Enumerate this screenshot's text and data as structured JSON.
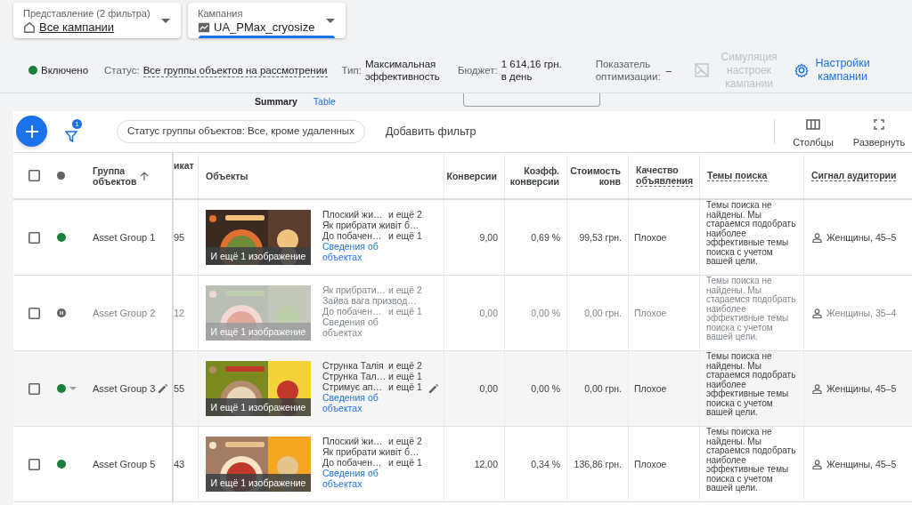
{
  "filters": [
    {
      "label": "Представление (2 фильтра)",
      "value": "Все кампании",
      "focused": false
    },
    {
      "label": "Кампания",
      "value": "UA_PMax_cryosize",
      "focused": true
    }
  ],
  "summary_bar": {
    "state": "Включено",
    "status_label": "Статус:",
    "status_value": "Все группы объектов на рассмотрении",
    "type_label": "Тип:",
    "type_value": "Максимальная эффективность",
    "budget_label": "Бюджет:",
    "budget_value": "1 614,16 грн. в день",
    "score_label": "Показатель оптимизации:",
    "score_value": "–",
    "simulation": {
      "label": "Симуляция настроек кампании",
      "disabled": true
    },
    "settings": "Настройки кампании"
  },
  "view_toggle": [
    {
      "label": "Summary",
      "selected": false
    },
    {
      "label": "Table",
      "selected": true
    }
  ],
  "toolbar": {
    "filter_count": "1",
    "filter_chip": "Статус группы объектов: Все, кроме удаленных",
    "add_filter": "Добавить фильтр",
    "columns": "Столбцы",
    "expand": "Развернуть"
  },
  "table": {
    "columns": [
      {
        "kind": "checkbox",
        "checked": false
      },
      {
        "kind": "status"
      },
      {
        "kind": "text",
        "label": "Группа объектов",
        "sorted": true
      },
      {
        "kind": "text",
        "label": "икат"
      },
      {
        "kind": "text",
        "label": "Объекты"
      },
      {
        "kind": "metric",
        "label": "Конверсии"
      },
      {
        "kind": "metric",
        "label": "Коэфф. конверсии"
      },
      {
        "kind": "metric",
        "label": "Стоимость конв"
      },
      {
        "kind": "hint",
        "label": "Качество объявления"
      },
      {
        "kind": "hint",
        "label": "Темы поиска"
      },
      {
        "kind": "hint",
        "label": "Сигнал аудитории"
      }
    ],
    "rows": [
      {
        "checked": false,
        "paused": false,
        "hovered": false,
        "name": "Asset Group 1",
        "column_3": "95",
        "images_more": "И ещё 1 изображение",
        "headlines": [
          {
            "text": "Плоский жи…",
            "more": "и ещё 2"
          },
          {
            "text": "Як прибрати живіт б…"
          },
          {
            "text": "До побачен…",
            "more": "и ещё 1"
          }
        ],
        "details_link": "Сведения об объектах",
        "conversions": "9,00",
        "conv_rate": "0,69 %",
        "cost_per_conv": "99,53 грн.",
        "ad_strength": "Плохое",
        "search_themes": "Темы поиска не найдены. Мы стараемся подобрать наиболее эффективные темы поиска с учетом вашей цели.",
        "audience_signal": "Женщины, 45–5"
      },
      {
        "checked": false,
        "paused": true,
        "hovered": false,
        "name": "Asset Group 2",
        "column_3": "12",
        "images_more": "И ещё 1 изображение",
        "headlines": [
          {
            "text": "Як прибрати…",
            "more": "и ещё 2"
          },
          {
            "text": "Зайва вага призвод…"
          },
          {
            "text": "До побачен…",
            "more": "и ещё 1"
          }
        ],
        "details_link": "Сведения об объектах",
        "conversions": "0,00",
        "conv_rate": "0,00 %",
        "cost_per_conv": "0,00 грн.",
        "ad_strength": "Плохое",
        "search_themes": "Темы поиска не найдены. Мы стараемся подобрать наиболее эффективные темы поиска с учетом вашей цели.",
        "audience_signal": "Женщины, 35–4"
      },
      {
        "checked": false,
        "paused": false,
        "hovered": true,
        "name": "Asset Group 3",
        "column_3": "55",
        "images_more": "И ещё 1 изображение",
        "headlines": [
          {
            "text": "Струнка Талія",
            "more": "и ещё 2"
          },
          {
            "text": "Струнка Тал…",
            "more": "и ещё 1"
          },
          {
            "text": "Стримує ап…",
            "more": "и ещё 1"
          }
        ],
        "details_link": "Сведения об объектах",
        "conversions": "0,00",
        "conv_rate": "0,00 %",
        "cost_per_conv": "0,00 грн.",
        "ad_strength": "Плохое",
        "search_themes": "Темы поиска не найдены. Мы стараемся подобрать наиболее эффективные темы поиска с учетом вашей цели.",
        "audience_signal": "Женщины, 45–5"
      },
      {
        "checked": false,
        "paused": false,
        "hovered": false,
        "name": "Asset Group 5",
        "column_3": "43",
        "images_more": "И ещё 1 изображение",
        "headlines": [
          {
            "text": "Плоский жи…",
            "more": "и ещё 2"
          },
          {
            "text": "Як прибрати живіт б…"
          },
          {
            "text": "До побачен…",
            "more": "и ещё 1"
          }
        ],
        "details_link": "Сведения об объектах",
        "conversions": "12,00",
        "conv_rate": "0,34 %",
        "cost_per_conv": "136,86 грн.",
        "ad_strength": "Плохое",
        "search_themes": "Темы поиска не найдены. Мы стараемся подобрать наиболее эффективные темы поиска с учетом вашей цели.",
        "audience_signal": "Женщины, 45–5"
      }
    ]
  }
}
